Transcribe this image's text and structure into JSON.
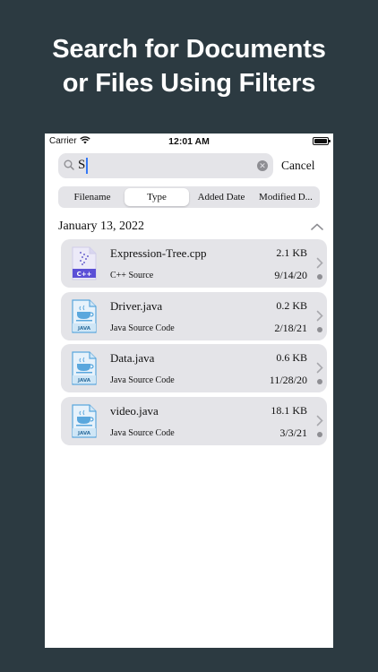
{
  "headline": {
    "line1": "Search for Documents",
    "line2": "or Files Using Filters"
  },
  "status_bar": {
    "carrier": "Carrier",
    "time": "12:01 AM"
  },
  "search": {
    "query": "S",
    "cancel_label": "Cancel"
  },
  "filters": {
    "items": [
      "Filename",
      "Type",
      "Added Date",
      "Modified D..."
    ],
    "selected": "Type"
  },
  "section": {
    "title": "January 13, 2022"
  },
  "files": [
    {
      "name": "Expression-Tree.cpp",
      "type": "C++ Source",
      "size": "2.1 KB",
      "date": "9/14/20",
      "icon": "cpp-file-icon",
      "badge": "C++"
    },
    {
      "name": "Driver.java",
      "type": "Java Source Code",
      "size": "0.2 KB",
      "date": "2/18/21",
      "icon": "java-file-icon",
      "badge": "JAVA"
    },
    {
      "name": "Data.java",
      "type": "Java Source Code",
      "size": "0.6 KB",
      "date": "11/28/20",
      "icon": "java-file-icon",
      "badge": "JAVA"
    },
    {
      "name": "video.java",
      "type": "Java Source Code",
      "size": "18.1 KB",
      "date": "3/3/21",
      "icon": "java-file-icon",
      "badge": "JAVA"
    }
  ],
  "colors": {
    "background": "#2c3a41",
    "accent": "#3478f6",
    "cpp_badge": "#5b4fd6",
    "java_icon": "#5aa7dd"
  }
}
